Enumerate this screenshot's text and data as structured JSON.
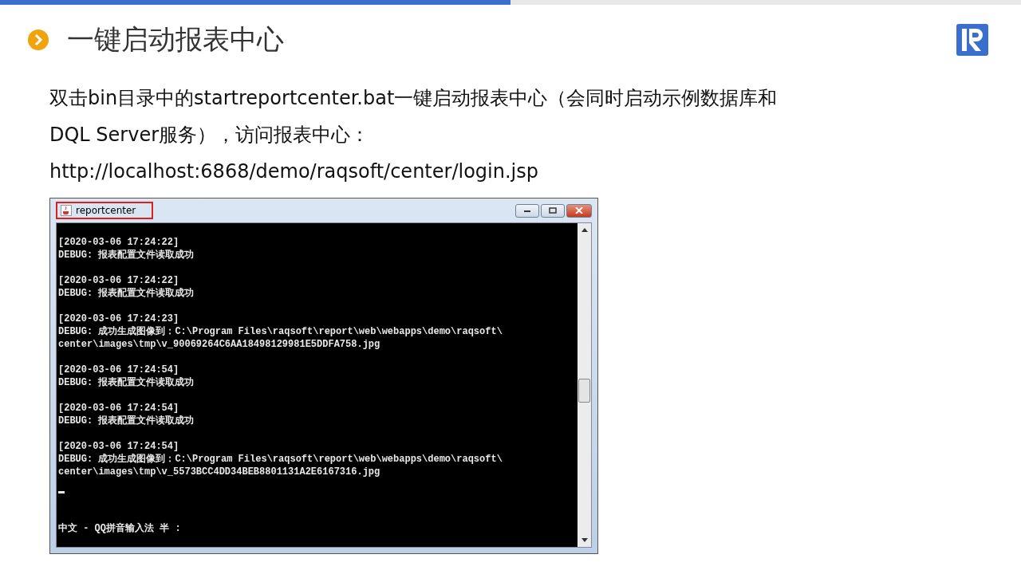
{
  "progress": {
    "level": 0.5
  },
  "heading": "一键启动报表中心",
  "paragraph": "双击bin目录中的startreportcenter.bat一键启动报表中心（会同时启动示例数据库和DQL Server服务），访问报表中心：",
  "url": "http://localhost:6868/demo/raqsoft/center/login.jsp",
  "console": {
    "title": "reportcenter",
    "title_highlighted": true,
    "entries": [
      {
        "lines": [
          "[2020-03-06 17:24:22]",
          "DEBUG: 报表配置文件读取成功"
        ]
      },
      {
        "lines": [
          "[2020-03-06 17:24:22]",
          "DEBUG: 报表配置文件读取成功"
        ]
      },
      {
        "lines": [
          "[2020-03-06 17:24:23]",
          "DEBUG: 成功生成图像到：C:\\Program Files\\raqsoft\\report\\web\\webapps\\demo\\raqsoft\\",
          "center\\images\\tmp\\v_90069264C6AA18498129981E5DDFA758.jpg"
        ]
      },
      {
        "lines": [
          "[2020-03-06 17:24:54]",
          "DEBUG: 报表配置文件读取成功"
        ]
      },
      {
        "lines": [
          "[2020-03-06 17:24:54]",
          "DEBUG: 报表配置文件读取成功"
        ]
      },
      {
        "lines": [
          "[2020-03-06 17:24:54]",
          "DEBUG: 成功生成图像到：C:\\Program Files\\raqsoft\\report\\web\\webapps\\demo\\raqsoft\\",
          "center\\images\\tmp\\v_5573BCC4DD34BEB8801131A2E6167316.jpg"
        ]
      }
    ],
    "ime_status": "中文 - QQ拼音输入法 半 :"
  }
}
